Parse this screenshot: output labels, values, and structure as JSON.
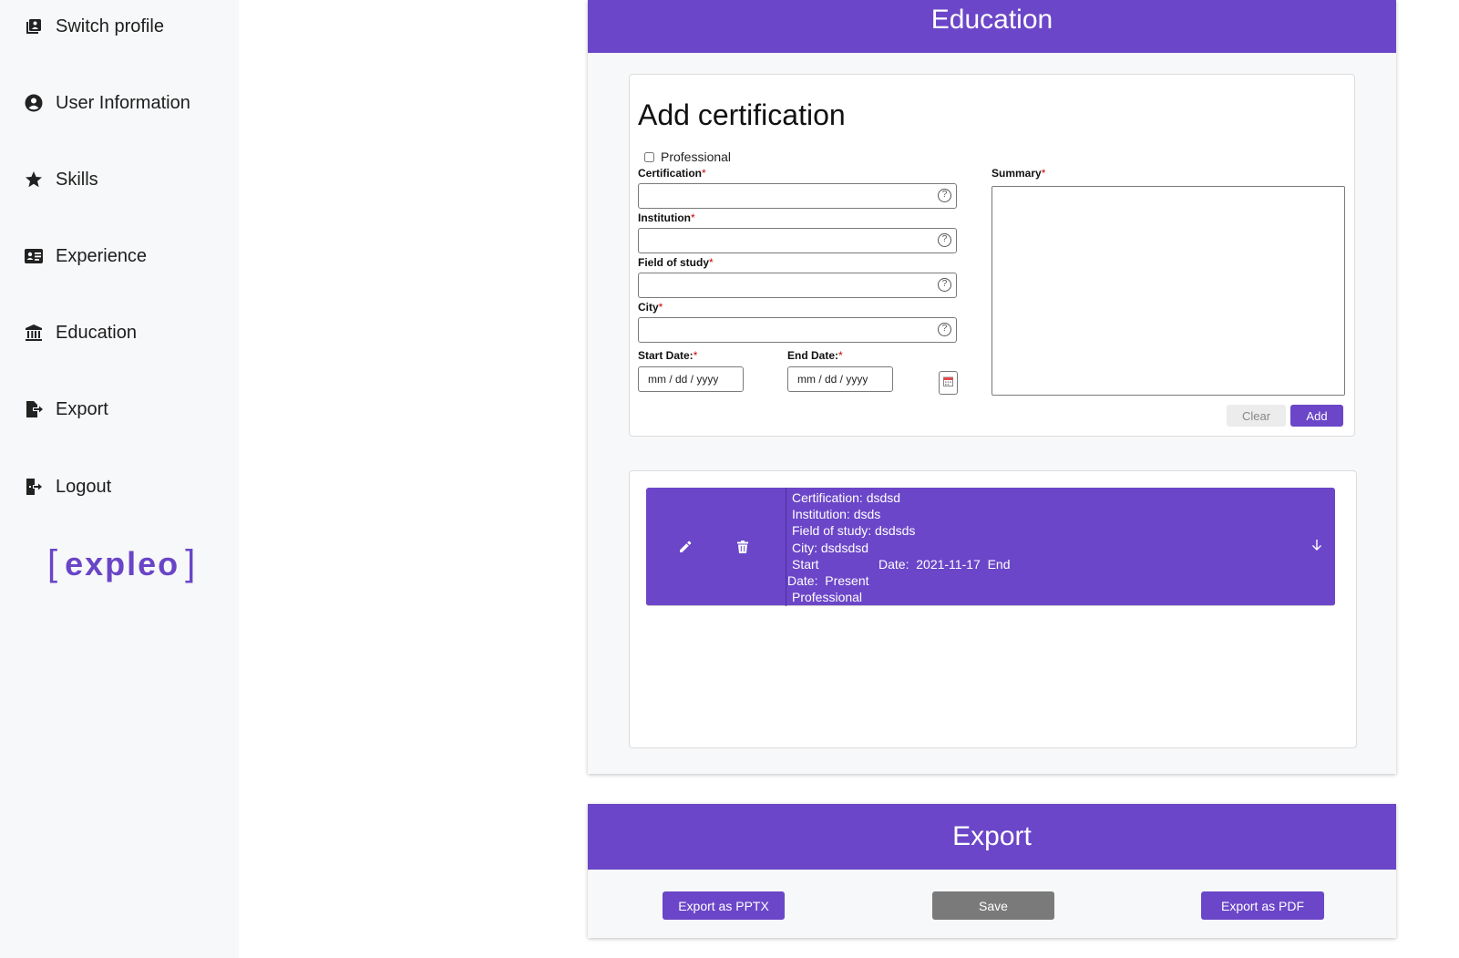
{
  "sidebar": {
    "items": [
      {
        "label": "Switch profile",
        "icon": "switch-profile-icon"
      },
      {
        "label": "User Information",
        "icon": "user-circle-icon"
      },
      {
        "label": "Skills",
        "icon": "star-icon"
      },
      {
        "label": "Experience",
        "icon": "id-card-icon"
      },
      {
        "label": "Education",
        "icon": "institution-icon"
      },
      {
        "label": "Export",
        "icon": "export-file-icon"
      },
      {
        "label": "Logout",
        "icon": "logout-icon"
      }
    ],
    "logo_text": "expleo"
  },
  "education": {
    "title": "Education",
    "form": {
      "title": "Add certification",
      "professional_label": "Professional",
      "professional_checked": false,
      "certification_label": "Certification",
      "institution_label": "Institution",
      "field_of_study_label": "Field of study",
      "city_label": "City",
      "start_date_label": "Start Date:",
      "end_date_label": "End Date:",
      "summary_label": "Summary",
      "required_mark": "*",
      "date_placeholder": "mm / dd / yyyy",
      "help_glyph": "?",
      "clear_label": "Clear",
      "add_label": "Add"
    },
    "entries": [
      {
        "certification": "Certification: dsdsd",
        "institution": "Institution: dsds",
        "field_of_study": "Field of study: dsdsds",
        "city": "City: dsdsdsd",
        "start_word": "Start",
        "start_date": "Date:  2021-11-17  End",
        "end_date": "Date:  Present",
        "type": "Professional"
      }
    ]
  },
  "export": {
    "title": "Export",
    "pptx_label": "Export as PPTX",
    "save_label": "Save",
    "pdf_label": "Export as PDF"
  },
  "colors": {
    "accent": "#6b46c8",
    "sidebar_bg": "#f7f8f9",
    "save_button": "#7a7a7a"
  }
}
